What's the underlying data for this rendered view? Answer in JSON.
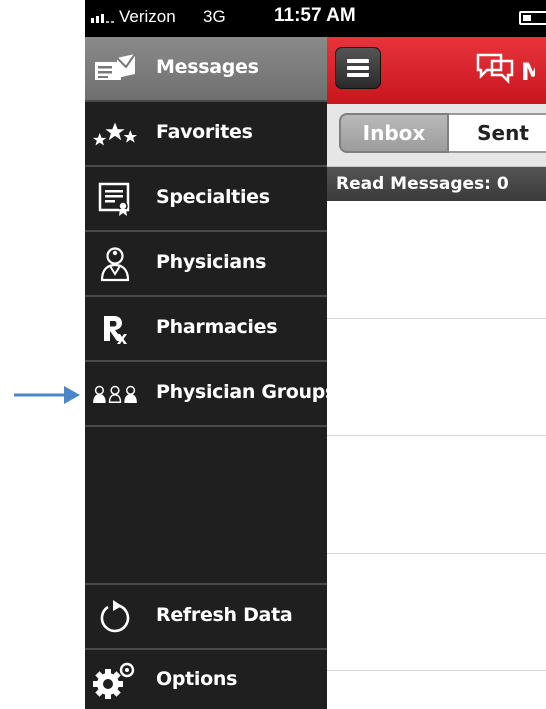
{
  "status_bar": {
    "carrier": "Verizon",
    "network": "3G",
    "time": "11:57 AM"
  },
  "sidebar": {
    "items": [
      {
        "label": "Messages",
        "icon": "messages-icon",
        "active": true
      },
      {
        "label": "Favorites",
        "icon": "stars-icon"
      },
      {
        "label": "Specialties",
        "icon": "certificate-icon"
      },
      {
        "label": "Physicians",
        "icon": "physician-icon"
      },
      {
        "label": "Pharmacies",
        "icon": "rx-icon"
      },
      {
        "label": "Physician Groups",
        "icon": "physician-group-icon"
      }
    ],
    "bottom_items": [
      {
        "label": "Refresh Data",
        "icon": "refresh-icon"
      },
      {
        "label": "Options",
        "icon": "gears-icon"
      }
    ]
  },
  "main": {
    "logo_text": "M",
    "tabs": [
      {
        "label": "Inbox",
        "selected": true
      },
      {
        "label": "Sent"
      }
    ],
    "read_messages": "Read Messages: 0"
  },
  "colors": {
    "accent": "#d4202a",
    "sidebar_bg": "#1f1f1f",
    "annotation_arrow": "#4a86c8"
  }
}
